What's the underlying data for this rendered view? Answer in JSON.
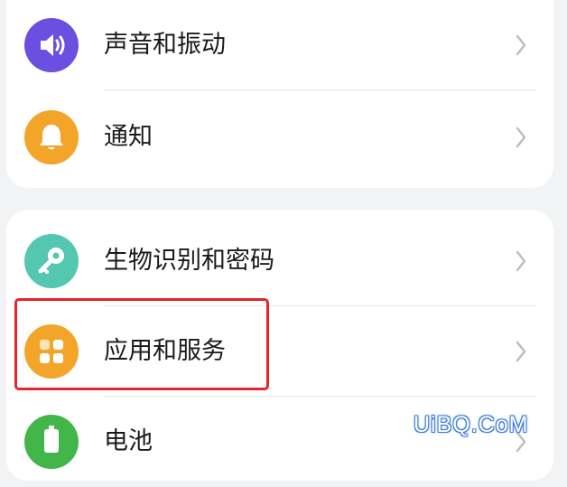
{
  "settings": {
    "group1": [
      {
        "id": "sound",
        "label": "声音和振动",
        "icon": "speaker-icon",
        "color": "#6a4fe0"
      },
      {
        "id": "notifications",
        "label": "通知",
        "icon": "bell-icon",
        "color": "#f3a52a"
      }
    ],
    "group2": [
      {
        "id": "biometrics",
        "label": "生物识别和密码",
        "icon": "key-icon",
        "color": "#54c7b0"
      },
      {
        "id": "apps",
        "label": "应用和服务",
        "icon": "apps-grid-icon",
        "color": "#f3a52a"
      },
      {
        "id": "battery",
        "label": "电池",
        "icon": "battery-icon",
        "color": "#43b649"
      }
    ]
  },
  "highlight": {
    "color": "#e6242b"
  },
  "watermark": {
    "text": "UiBQ.CoM"
  }
}
